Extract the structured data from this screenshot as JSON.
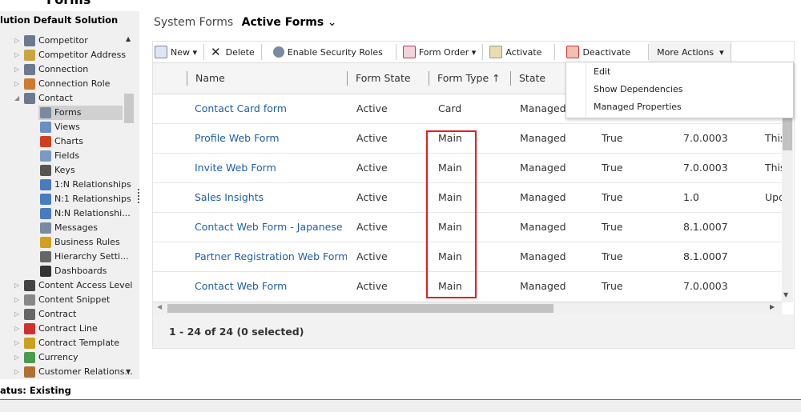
{
  "app_title": "Forms",
  "solution_title": "lution Default Solution",
  "sidebar": {
    "items": [
      {
        "label": "Competitor",
        "level": 0,
        "icon": "people-icon",
        "expanded": false
      },
      {
        "label": "Competitor Address",
        "level": 0,
        "icon": "address-icon",
        "expanded": false
      },
      {
        "label": "Connection",
        "level": 0,
        "icon": "connection-icon",
        "expanded": false
      },
      {
        "label": "Connection Role",
        "level": 0,
        "icon": "connection-role-icon",
        "expanded": false
      },
      {
        "label": "Contact",
        "level": 0,
        "icon": "contact-card-icon",
        "expanded": true
      },
      {
        "label": "Forms",
        "level": 1,
        "icon": "form-icon",
        "selected": true
      },
      {
        "label": "Views",
        "level": 1,
        "icon": "view-icon"
      },
      {
        "label": "Charts",
        "level": 1,
        "icon": "chart-icon"
      },
      {
        "label": "Fields",
        "level": 1,
        "icon": "fields-icon"
      },
      {
        "label": "Keys",
        "level": 1,
        "icon": "key-icon"
      },
      {
        "label": "1:N Relationships",
        "level": 1,
        "icon": "relationship-icon"
      },
      {
        "label": "N:1 Relationships",
        "level": 1,
        "icon": "relationship-icon"
      },
      {
        "label": "N:N Relationshi...",
        "level": 1,
        "icon": "relationship-icon"
      },
      {
        "label": "Messages",
        "level": 1,
        "icon": "messages-icon"
      },
      {
        "label": "Business Rules",
        "level": 1,
        "icon": "business-rules-icon"
      },
      {
        "label": "Hierarchy Setti...",
        "level": 1,
        "icon": "hierarchy-icon"
      },
      {
        "label": "Dashboards",
        "level": 1,
        "icon": "dashboard-icon"
      },
      {
        "label": "Content Access Level",
        "level": 0,
        "icon": "lock-icon",
        "expanded": false
      },
      {
        "label": "Content Snippet",
        "level": 0,
        "icon": "scissors-icon",
        "expanded": false
      },
      {
        "label": "Contract",
        "level": 0,
        "icon": "contract-icon",
        "expanded": false
      },
      {
        "label": "Contract Line",
        "level": 0,
        "icon": "contract-line-icon",
        "expanded": false
      },
      {
        "label": "Contract Template",
        "level": 0,
        "icon": "contract-template-icon",
        "expanded": false
      },
      {
        "label": "Currency",
        "level": 0,
        "icon": "currency-icon",
        "expanded": false
      },
      {
        "label": "Customer Relations...",
        "level": 0,
        "icon": "customer-relationship-icon",
        "expanded": false
      }
    ]
  },
  "header": {
    "breadcrumb": "System Forms",
    "view": "Active Forms",
    "chevron": "⌄"
  },
  "toolbar": {
    "new": "New",
    "delete": "Delete",
    "enable_security": "Enable Security Roles",
    "form_order": "Form Order",
    "activate": "Activate",
    "deactivate": "Deactivate",
    "more_actions": "More Actions"
  },
  "more_actions_menu": [
    "Edit",
    "Show Dependencies",
    "Managed Properties"
  ],
  "columns": [
    "Name",
    "Form State",
    "Form Type ↑",
    "State"
  ],
  "rows": [
    {
      "name": "Contact Card form",
      "form_state": "Active",
      "form_type": "Card",
      "state": "Managed",
      "c5": "",
      "c6": "",
      "c7": ""
    },
    {
      "name": "Profile Web Form",
      "form_state": "Active",
      "form_type": "Main",
      "state": "Managed",
      "c5": "True",
      "c6": "7.0.0003",
      "c7": "This"
    },
    {
      "name": "Invite Web Form",
      "form_state": "Active",
      "form_type": "Main",
      "state": "Managed",
      "c5": "True",
      "c6": "7.0.0003",
      "c7": "This"
    },
    {
      "name": "Sales Insights",
      "form_state": "Active",
      "form_type": "Main",
      "state": "Managed",
      "c5": "True",
      "c6": "1.0",
      "c7": "Upd"
    },
    {
      "name": "Contact Web Form - Japanese",
      "form_state": "Active",
      "form_type": "Main",
      "state": "Managed",
      "c5": "True",
      "c6": "8.1.0007",
      "c7": ""
    },
    {
      "name": "Partner Registration Web Form...",
      "form_state": "Active",
      "form_type": "Main",
      "state": "Managed",
      "c5": "True",
      "c6": "8.1.0007",
      "c7": ""
    },
    {
      "name": "Contact Web Form",
      "form_state": "Active",
      "form_type": "Main",
      "state": "Managed",
      "c5": "True",
      "c6": "7.0.0003",
      "c7": ""
    }
  ],
  "footer": {
    "count": "1 - 24 of 24 (0 selected)"
  },
  "status": "atus: Existing",
  "colors": {
    "link": "#1f5fa8",
    "highlight_box": "#e02020",
    "sidebar_bg": "#f0f0f0"
  }
}
